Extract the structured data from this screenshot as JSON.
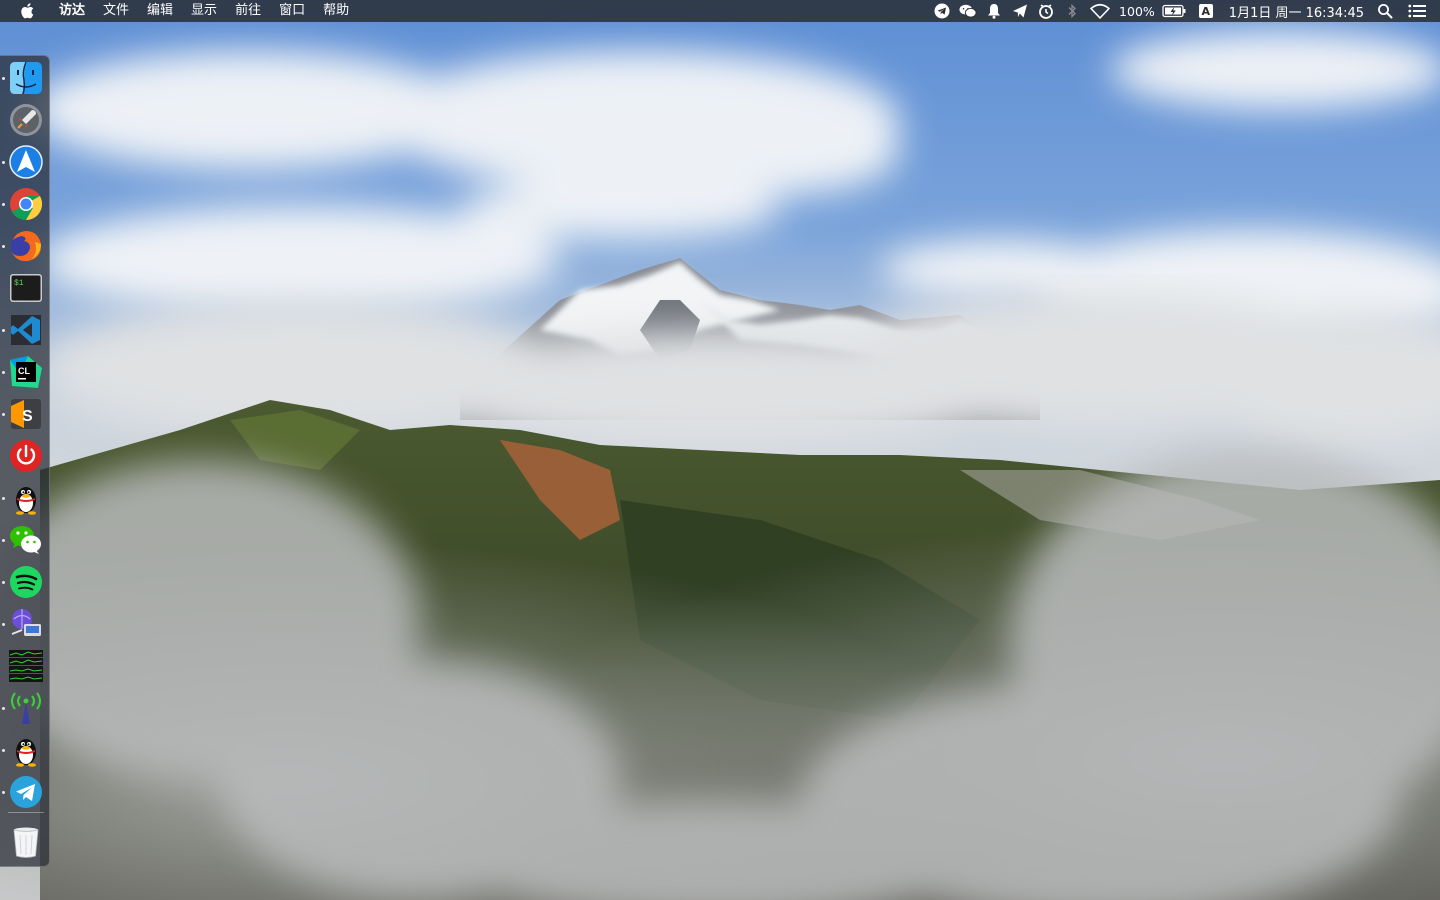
{
  "menubar": {
    "apple_icon": "apple-logo-icon",
    "menus": [
      "访达",
      "文件",
      "编辑",
      "显示",
      "前往",
      "窗口",
      "帮助"
    ],
    "status": {
      "battery_percent": "100%",
      "input_source": "A",
      "clock": "1月1日 周一  16:34:45"
    },
    "tray_icons": [
      "telegram-tray-icon",
      "wechat-tray-icon",
      "notification-bell-icon",
      "paper-plane-icon",
      "clock-sync-icon",
      "bluetooth-icon",
      "wifi-icon",
      "battery-charging-icon",
      "search-icon",
      "notification-center-icon"
    ]
  },
  "dock": {
    "apps": [
      {
        "name": "Finder",
        "icon": "finder-icon",
        "running": true
      },
      {
        "name": "Launchpad",
        "icon": "launchpad-rocket-icon",
        "running": false
      },
      {
        "name": "Navigation",
        "icon": "navigation-arrow-icon",
        "running": true
      },
      {
        "name": "Google Chrome",
        "icon": "chrome-icon",
        "running": true
      },
      {
        "name": "Firefox",
        "icon": "firefox-icon",
        "running": true
      },
      {
        "name": "Terminal",
        "icon": "terminal-icon",
        "running": false
      },
      {
        "name": "Visual Studio Code",
        "icon": "vscode-icon",
        "running": true
      },
      {
        "name": "CLion",
        "icon": "clion-icon",
        "running": true
      },
      {
        "name": "Sublime Text",
        "icon": "sublime-icon",
        "running": true
      },
      {
        "name": "Power",
        "icon": "power-icon",
        "running": false
      },
      {
        "name": "QQ",
        "icon": "qq-penguin-icon",
        "running": true
      },
      {
        "name": "WeChat",
        "icon": "wechat-icon",
        "running": true
      },
      {
        "name": "Spotify",
        "icon": "spotify-icon",
        "running": true
      },
      {
        "name": "Network Utility",
        "icon": "network-utility-icon",
        "running": true
      },
      {
        "name": "Activity Monitor",
        "icon": "activity-monitor-icon",
        "running": false
      },
      {
        "name": "Wireless Diagnostics",
        "icon": "wireless-antenna-icon",
        "running": true
      },
      {
        "name": "QQ",
        "icon": "qq-penguin-icon",
        "running": true
      },
      {
        "name": "Telegram",
        "icon": "telegram-icon",
        "running": true
      }
    ],
    "trash": {
      "name": "Trash",
      "icon": "trash-icon"
    }
  },
  "colors": {
    "sky": "#5f8fd0",
    "menubar": "#26282e",
    "dock": "#282c34"
  }
}
